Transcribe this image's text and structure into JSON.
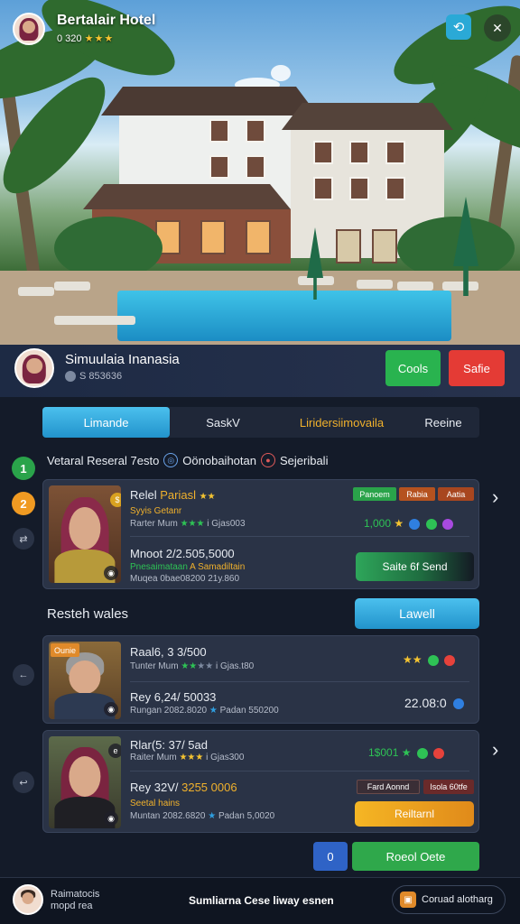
{
  "hero": {
    "title": "Bertalair Hotel",
    "subtitle": "0 320",
    "stars": "★★★"
  },
  "profile": {
    "name": "Simuulaia Inanasia",
    "sub": "S 853636",
    "btn_green": "Cools",
    "btn_red": "Safie"
  },
  "tabs": [
    {
      "label": "Limande"
    },
    {
      "label": "SaskV"
    },
    {
      "label": "Liridersiimovaila"
    },
    {
      "label": "Reeine"
    }
  ],
  "steps": [
    "1",
    "2"
  ],
  "section1": {
    "title": "Vetaral Reseral 7esto",
    "link1": "Oönobaihotan",
    "link2": "Sejeribali"
  },
  "card1": {
    "name": "Relel",
    "name_accent": "Pariasl",
    "stars": "★★",
    "sub1": "Syyis Getanr",
    "sub2_label": "Rarter Mum",
    "sub2_stars": "★★★",
    "sub2_extra": "i Gjas003",
    "price": "1,000",
    "tags": [
      "Panoem",
      "Rabia",
      "Aatia"
    ],
    "line2": "Mnoot 2/2.505,5000",
    "line2_sub1": "Pnesaimataan",
    "line2_sub1b": "A Samadiltain",
    "line2_sub2": "Muqea 0bae08200",
    "line2_sub2b": "21y.860",
    "btn": "Saite 6f Send"
  },
  "section2": {
    "title": "Resteh wales",
    "btn": "Lawell"
  },
  "card2": {
    "badge": "Ounie",
    "name": "Raal6, 3 3/500",
    "sub_label": "Tunter Mum",
    "sub_stars": "★★",
    "sub_stars_dim": "★★",
    "sub_extra": "i Gjas.t80",
    "line2": "Rey 6,24/ 50033",
    "line2_sub": "Rungan 2082.8020",
    "line2_sub2": "Padan 550200",
    "price": "22.08:0",
    "stars": "★★"
  },
  "card3": {
    "name": "Rlar(5: 37/ 5ad",
    "sub_label": "Raiter Mum",
    "sub_stars": "★★★",
    "sub_extra": "i Gjas300",
    "line2": "Rey 32V/",
    "line2_accent": "3255 0006",
    "line2_sub1": "Seetal hains",
    "line2_sub2": "Muntan 2082.6820",
    "line2_sub2b": "Padan 5,0020",
    "price": "1$001",
    "chips": [
      "Fard Aonnd",
      "Isola 60tfe"
    ],
    "btn": "Reiltarnl"
  },
  "bottom": {
    "num": "0",
    "btn": "Roeol Oete"
  },
  "footer": {
    "left1": "Raimatocis",
    "left2": "mopd rea",
    "center": "Sumliarna Cese liway esnen",
    "right": "Coruad alotharg"
  },
  "icons": {
    "share": "share-icon",
    "more": "more-icon",
    "back": "back-arrow-icon",
    "chevron": "chevron-right-icon"
  }
}
